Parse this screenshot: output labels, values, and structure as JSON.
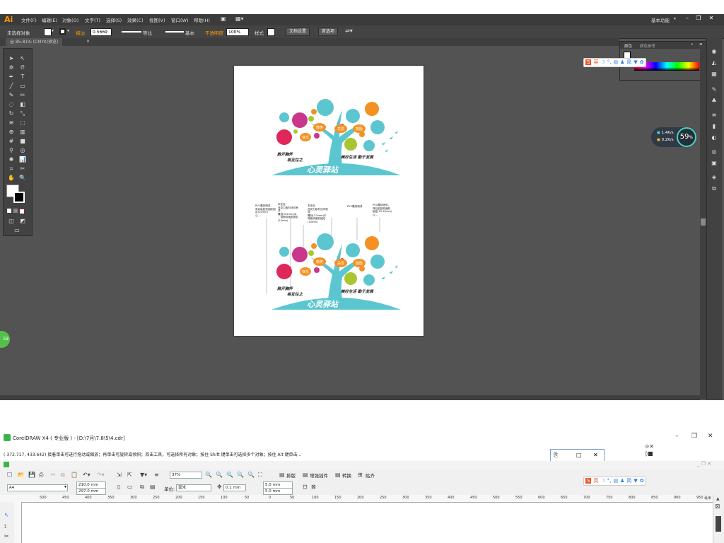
{
  "illustrator": {
    "logo": "Ai",
    "menu": [
      "文件(F)",
      "编辑(E)",
      "对象(O)",
      "文字(T)",
      "选择(S)",
      "效果(C)",
      "视图(V)",
      "窗口(W)",
      "帮助(H)"
    ],
    "workspace": "基本功能",
    "control": {
      "selection": "未选择对象",
      "stroke_label": "描边",
      "stroke_value": "0.5669",
      "stroke_style": "等比",
      "brush": "基本",
      "opacity_label": "不透明度",
      "opacity_value": "100%",
      "style_label": "样式",
      "doc_setup": "文档设置",
      "preferences": "首选项"
    },
    "doc_tab": "@ 85.81% (CMYK/预览)",
    "color_panel": {
      "tab1": "颜色",
      "tab2": "颜色参考"
    },
    "speed": {
      "up": "1.4K/s",
      "down": "0.2K/s",
      "percent": "59",
      "percent_sign": "%"
    },
    "green_badge": "59"
  },
  "ime": {
    "logo": "S",
    "lang": "英"
  },
  "artwork": {
    "design1": {
      "hearts": [
        "微笑",
        "关爱",
        "鼓励",
        "快乐"
      ],
      "slogan_left_1": "敞开胸怀",
      "slogan_left_2": "相互往之",
      "slogan_right": "美好生活 勤于发展",
      "banner": "心灵驿站"
    },
    "design2": {
      "hearts": [
        "微笑",
        "关爱",
        "鼓励",
        "快乐"
      ],
      "slogan_left_1": "敞开胸怀",
      "slogan_left_2": "相互往之",
      "slogan_right": "美好生活 勤于发展",
      "banner": "心灵驿站",
      "notes": [
        "PVC雕刻喷漆，\n背后粘贴双面胶固定(15mm)\n公…",
        "本亚克\n亚克力板材丝印喷漆\n雕刻(3-5mm)中\n，背面双面胶固定(10mm)",
        "本亚克\n亚克力板材丝印喷漆\n雕刻(3-5mm)中\n背面双面胶固定(10mm)",
        "PVC雕刻喷漆",
        "PVC雕刻喷漆，\n背后粘贴双面胶\n固定(15-20mm)公…"
      ]
    }
  },
  "corel": {
    "title": "CorelDRAW X4 ( 专业版 ) - [D:\\7月\\7.8\\5\\4.cdr]",
    "status": "(-372.717, 433.642)   接着单击可进行拖动或缩放；再单击可旋转或倾斜；双击工具，可选择所有对象；按住 Shift 键单击可选择多个对象；按住 Alt 键单击...",
    "zoom": "37%",
    "toolbar_labels": [
      "排版",
      "增强插件",
      "转换",
      "贴齐"
    ],
    "paper": "A4",
    "width": "210.0 mm",
    "height": "297.0 mm",
    "units_label": "单位:",
    "units": "毫米",
    "nudge": "0.1 mm",
    "dup_x": "5.0 mm",
    "dup_y": "5.0 mm",
    "ruler": [
      "500",
      "450",
      "400",
      "350",
      "300",
      "250",
      "200",
      "150",
      "100",
      "50",
      "0",
      "50",
      "100",
      "150",
      "200",
      "250",
      "300",
      "350",
      "400",
      "450",
      "500",
      "550",
      "600",
      "650",
      "700",
      "750",
      "800",
      "850",
      "900",
      "950"
    ],
    "ruler_unit": "毫米"
  },
  "colors": {
    "ai_bg": "#535353",
    "ai_dark": "#3b3b3b",
    "teal": "#5cc6d0",
    "magenta": "#c8378a",
    "crimson": "#e0275b",
    "orange": "#f39223",
    "lime": "#a8c630",
    "accent_orange": "#ff9a00"
  }
}
